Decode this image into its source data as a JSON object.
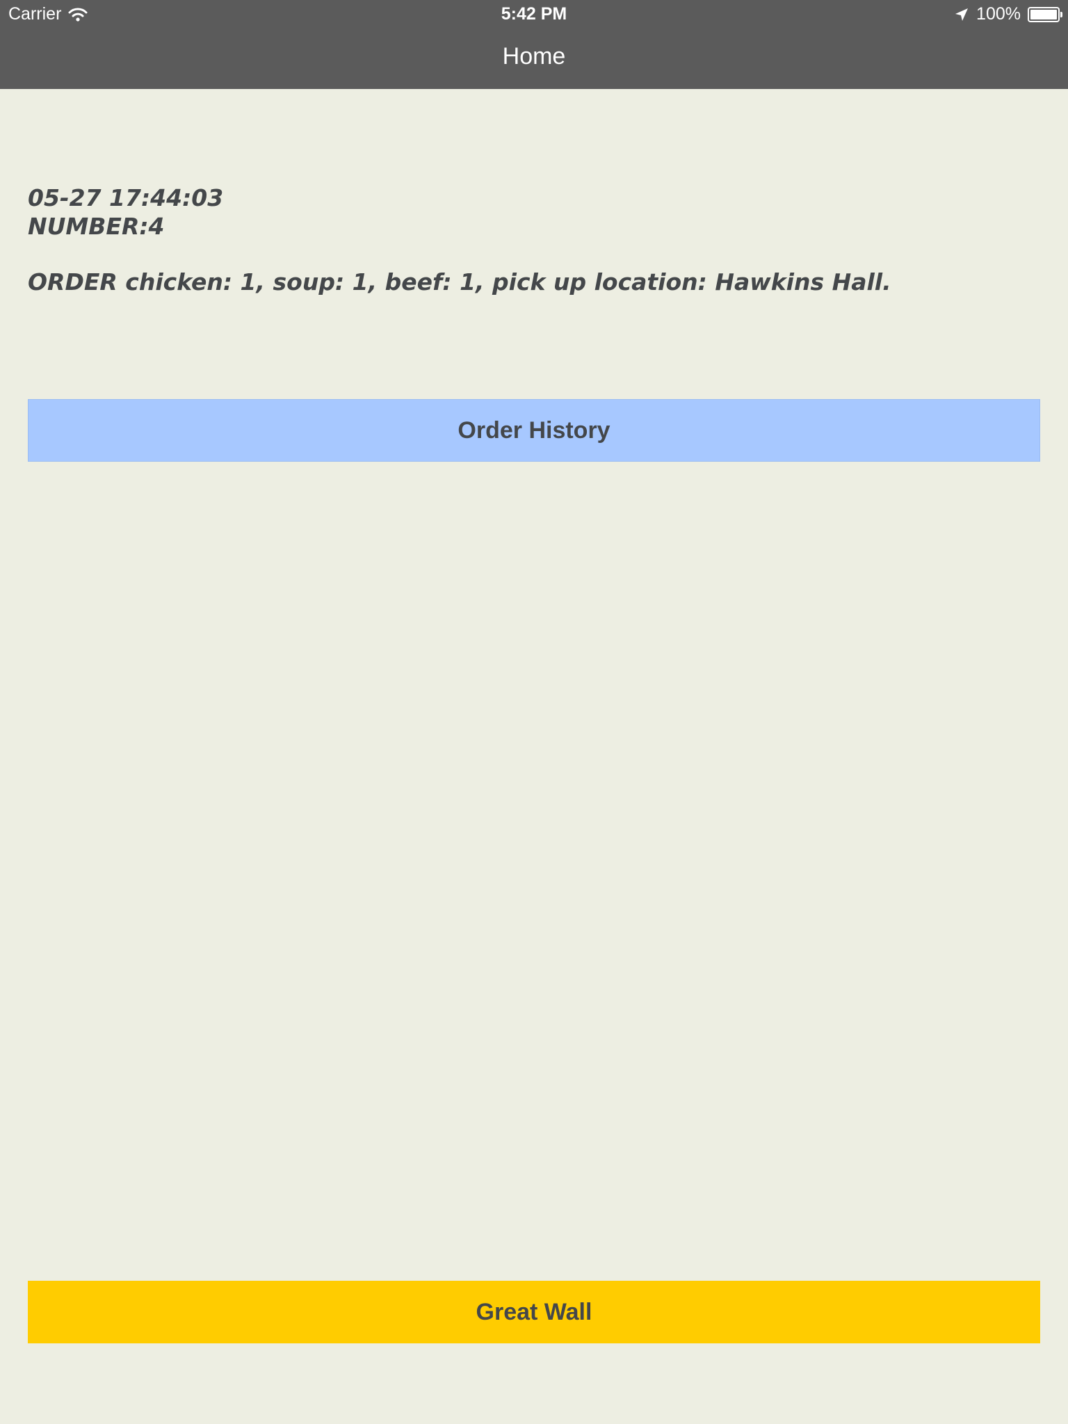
{
  "status_bar": {
    "carrier": "Carrier",
    "time": "5:42 PM",
    "battery": "100%",
    "icons": [
      "wifi-icon",
      "location-arrow-icon",
      "battery-icon"
    ]
  },
  "nav": {
    "title": "Home"
  },
  "order": {
    "timestamp": "05-27 17:44:03",
    "number": "NUMBER:4",
    "detail": "ORDER chicken: 1, soup: 1, beef: 1, pick up location: Hawkins Hall."
  },
  "buttons": {
    "history_label": "Order History",
    "restaurant_label": "Great Wall"
  },
  "colors": {
    "background": "#EDEEE2",
    "nav_bar": "#5B5B5B",
    "text": "#44474A",
    "history_button": "#A7C8FF",
    "restaurant_button": "#FFCC00"
  }
}
